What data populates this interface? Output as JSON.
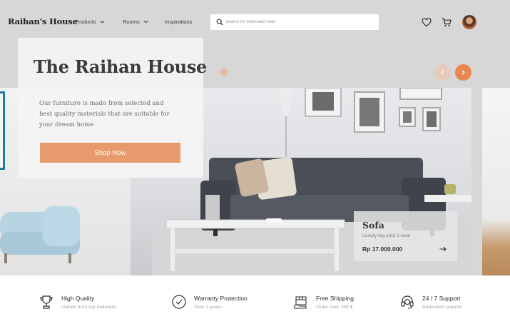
{
  "nav": {
    "brand": "Raihan's House",
    "menu": [
      {
        "label": "Products",
        "has_dropdown": true
      },
      {
        "label": "Rooms",
        "has_dropdown": true
      },
      {
        "label": "Inspirations",
        "has_dropdown": false
      }
    ],
    "search_placeholder": "Search for minimalist chair",
    "icons": [
      "search-icon",
      "heart-icon",
      "cart-icon",
      "avatar"
    ]
  },
  "hero": {
    "title": "The Raihan House",
    "description": "Our furniture is made from selected and best quality materials that are suitable for your dream home",
    "cta_label": "Shop Now",
    "accent_color": "#E79A6B",
    "carousel": {
      "prev_icon": "chevron-left-icon",
      "next_icon": "chevron-right-icon"
    }
  },
  "product_card": {
    "name": "Sofa",
    "description": "Luxury big sofa 2-seat",
    "price": "Rp 17.000.000",
    "icon": "arrow-right-icon"
  },
  "features": [
    {
      "title": "High Quality",
      "subtitle": "crafted from top materials",
      "icon": "trophy-icon"
    },
    {
      "title": "Warranty Protection",
      "subtitle": "Over 2 years",
      "icon": "check-badge-icon"
    },
    {
      "title": "Free Shipping",
      "subtitle": "Order over 150 $",
      "icon": "shipping-box-icon"
    },
    {
      "title": "24 / 7 Support",
      "subtitle": "Dedicated support",
      "icon": "headset-icon"
    }
  ]
}
